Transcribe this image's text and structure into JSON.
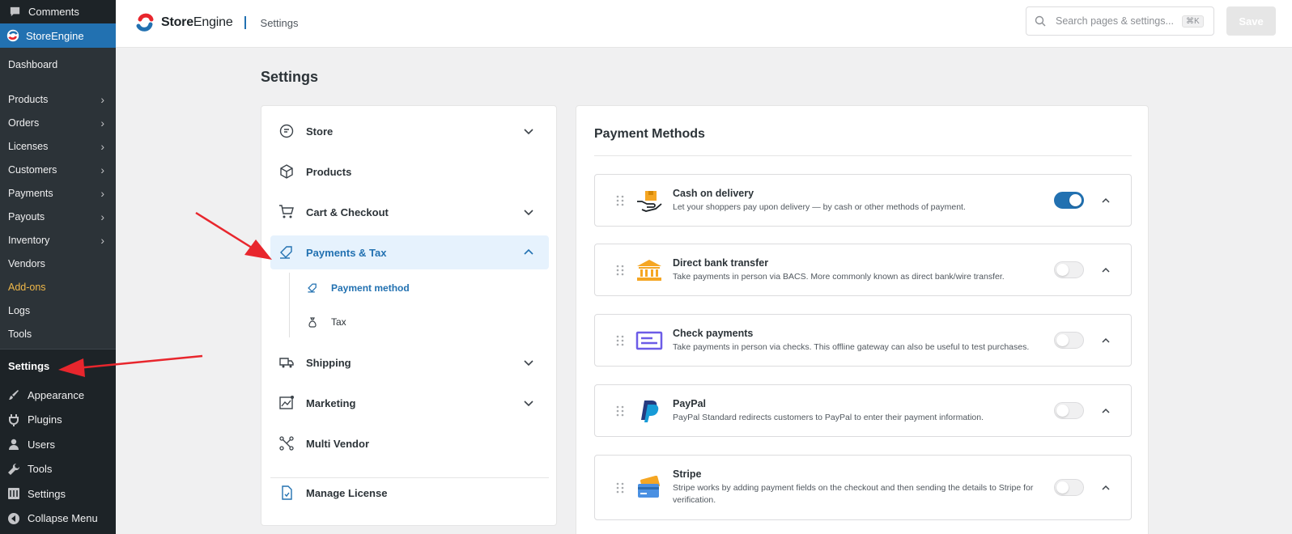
{
  "wp_menu": {
    "top_item": "Comments",
    "active_item": "StoreEngine",
    "sub_items": [
      {
        "label": "Dashboard",
        "has_chevron": false
      },
      {
        "label": "Products",
        "has_chevron": true
      },
      {
        "label": "Orders",
        "has_chevron": true
      },
      {
        "label": "Licenses",
        "has_chevron": true
      },
      {
        "label": "Customers",
        "has_chevron": true
      },
      {
        "label": "Payments",
        "has_chevron": true
      },
      {
        "label": "Payouts",
        "has_chevron": true
      },
      {
        "label": "Inventory",
        "has_chevron": true
      },
      {
        "label": "Vendors",
        "has_chevron": false
      },
      {
        "label": "Add-ons",
        "has_chevron": false
      },
      {
        "label": "Logs",
        "has_chevron": false
      },
      {
        "label": "Tools",
        "has_chevron": false
      }
    ],
    "settings_item": "Settings",
    "bottom_items": [
      "Appearance",
      "Plugins",
      "Users",
      "Tools",
      "Settings",
      "Collapse Menu"
    ]
  },
  "header": {
    "brand_part1": "Store",
    "brand_part2": "Engine",
    "breadcrumb": "Settings",
    "search_placeholder": "Search pages & settings...",
    "shortcut": "⌘K",
    "save_label": "Save"
  },
  "page_title": "Settings",
  "settings_nav": {
    "items": [
      {
        "label": "Store"
      },
      {
        "label": "Products"
      },
      {
        "label": "Cart & Checkout"
      },
      {
        "label": "Payments & Tax"
      },
      {
        "label": "Shipping"
      },
      {
        "label": "Marketing"
      },
      {
        "label": "Multi Vendor"
      },
      {
        "label": "Manage License"
      }
    ],
    "sub_items": [
      {
        "label": "Payment method"
      },
      {
        "label": "Tax"
      }
    ]
  },
  "payment_panel": {
    "title": "Payment Methods",
    "methods": [
      {
        "name": "Cash on delivery",
        "description": "Let your shoppers pay upon delivery — by cash or other methods of payment.",
        "enabled": true
      },
      {
        "name": "Direct bank transfer",
        "description": "Take payments in person via BACS. More commonly known as direct bank/wire transfer.",
        "enabled": false
      },
      {
        "name": "Check payments",
        "description": "Take payments in person via checks. This offline gateway can also be useful to test purchases.",
        "enabled": false
      },
      {
        "name": "PayPal",
        "description": "PayPal Standard redirects customers to PayPal to enter their payment information.",
        "enabled": false
      },
      {
        "name": "Stripe",
        "description": "Stripe works by adding payment fields on the checkout and then sending the details to Stripe for verification.",
        "enabled": false
      }
    ]
  },
  "colors": {
    "accent": "#2271b1",
    "sidebar_bg": "#1d2327",
    "addon": "#f0b849",
    "annotation": "#e8262d"
  }
}
